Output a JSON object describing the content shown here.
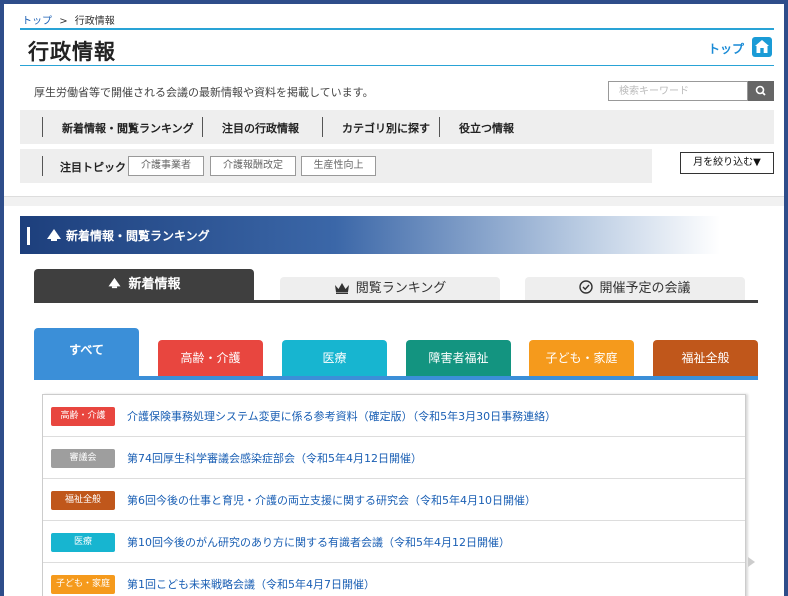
{
  "breadcrumb": {
    "home": "トップ",
    "separator": ">",
    "current": "行政情報"
  },
  "header": {
    "title": "行政情報",
    "top_link": "トップ"
  },
  "description": "厚生労働省等で開催される会議の最新情報や資料を掲載しています。",
  "search": {
    "placeholder": "検索キーワード"
  },
  "nav": {
    "items": [
      "新着情報・閲覧ランキング",
      "注目の行政情報",
      "カテゴリ別に探す",
      "役立つ情報"
    ]
  },
  "topics": {
    "label": "注目トピック",
    "tags": [
      "介護事業者",
      "介護報酬改定",
      "生産性向上"
    ]
  },
  "month_filter": "月を絞り込む▼",
  "section": {
    "title": "新着情報・閲覧ランキング"
  },
  "main_tabs": [
    {
      "label": "新着情報",
      "active": true
    },
    {
      "label": "閲覧ランキング",
      "active": false
    },
    {
      "label": "開催予定の会議",
      "active": false
    }
  ],
  "category_tabs": [
    {
      "label": "すべて",
      "color": "#3b8fd8",
      "active": true
    },
    {
      "label": "高齢・介護",
      "color": "#e8463f",
      "active": false
    },
    {
      "label": "医療",
      "color": "#17b5d0",
      "active": false
    },
    {
      "label": "障害者福祉",
      "color": "#139480",
      "active": false
    },
    {
      "label": "子ども・家庭",
      "color": "#f59a1c",
      "active": false
    },
    {
      "label": "福祉全般",
      "color": "#c0571b",
      "active": false
    }
  ],
  "items": [
    {
      "badge": "高齢・介護",
      "badge_color": "#e8463f",
      "text": "介護保険事務処理システム変更に係る参考資料（確定版）（令和5年3月30日事務連絡）"
    },
    {
      "badge": "審議会",
      "badge_color": "#9e9e9e",
      "text": "第74回厚生科学審議会感染症部会（令和5年4月12日開催）"
    },
    {
      "badge": "福祉全般",
      "badge_color": "#c0571b",
      "text": "第6回今後の仕事と育児・介護の両立支援に関する研究会（令和5年4月10日開催）"
    },
    {
      "badge": "医療",
      "badge_color": "#17b5d0",
      "text": "第10回今後のがん研究のあり方に関する有識者会議（令和5年4月12日開催）"
    },
    {
      "badge": "子ども・家庭",
      "badge_color": "#f59a1c",
      "text": "第1回こども未来戦略会議（令和5年4月7日開催）"
    }
  ]
}
